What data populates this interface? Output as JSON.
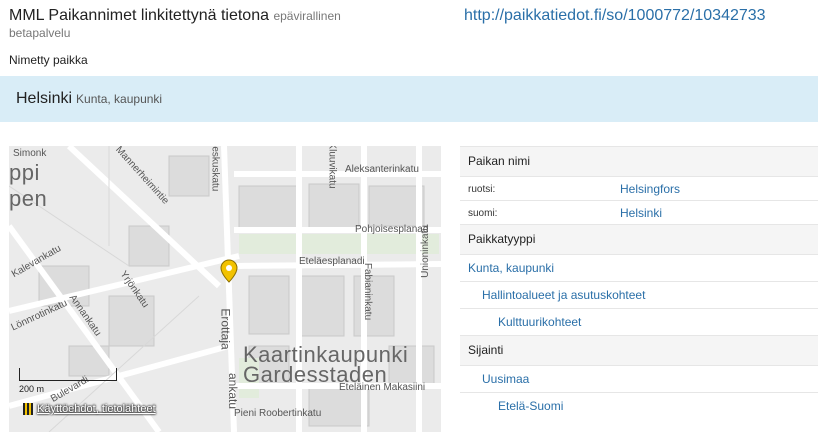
{
  "header": {
    "service_name": "MML Paikannimet",
    "service_suffix": "linkitettynä tietona",
    "status_note": "epävirallinen",
    "beta_note": "betapalvelu",
    "uri": "http://paikkatiedot.fi/so/1000772/10342733"
  },
  "entity_kind": "Nimetty paikka",
  "place": {
    "name": "Helsinki",
    "type": "Kunta, kaupunki"
  },
  "map": {
    "labels": {
      "simonkatu": "Simonk",
      "pippi": "ppi",
      "pen": "pen",
      "mannerheimintie": "Mannerheimintie",
      "keskuskatu": "Keskuskatu",
      "kluuvikatu": "Kluuvikatu",
      "aleksanterinkatu": "Aleksanterinkatu",
      "pohjoisesplanadi": "Pohjoisesplanad",
      "unioninkatu": "Unioninkatu",
      "etelaesplanadi": "Eteläesplanadi",
      "fabianinkatu": "Fabianinkatu",
      "kalevankatu": "Kalevankatu",
      "yrjonkatu": "Yrjönkatu",
      "annankatu": "Annankatu",
      "lonnrotinkatu": "Lönnrotinkatu",
      "erottaja": "Erottaja",
      "ankatu": "ankatu",
      "kaartinkaupunki": "Kaartinkaupunki",
      "gardesstaden": "Gardesstaden",
      "etelainen_makasiini": "Eteläinen Makasiini",
      "bulevardi": "Bulevardi",
      "pieni_roobertinkatu": "Pieni Roobertinkatu"
    },
    "scale_label": "200 m",
    "credits_label": "Käyttöehdot, tietolähteet",
    "marker_color": "#f2c200"
  },
  "table": {
    "names_header": "Paikan nimi",
    "names": [
      {
        "lang": "ruotsi:",
        "value": "Helsingfors"
      },
      {
        "lang": "suomi:",
        "value": "Helsinki"
      }
    ],
    "types_header": "Paikkatyyppi",
    "types": [
      "Kunta, kaupunki",
      "Hallintoalueet ja asutuskohteet",
      "Kulttuurikohteet"
    ],
    "location_header": "Sijainti",
    "locations": [
      "Uusimaa",
      "Etelä-Suomi"
    ]
  },
  "colors": {
    "link": "#2a6fa8",
    "banner": "#d9edf7"
  }
}
